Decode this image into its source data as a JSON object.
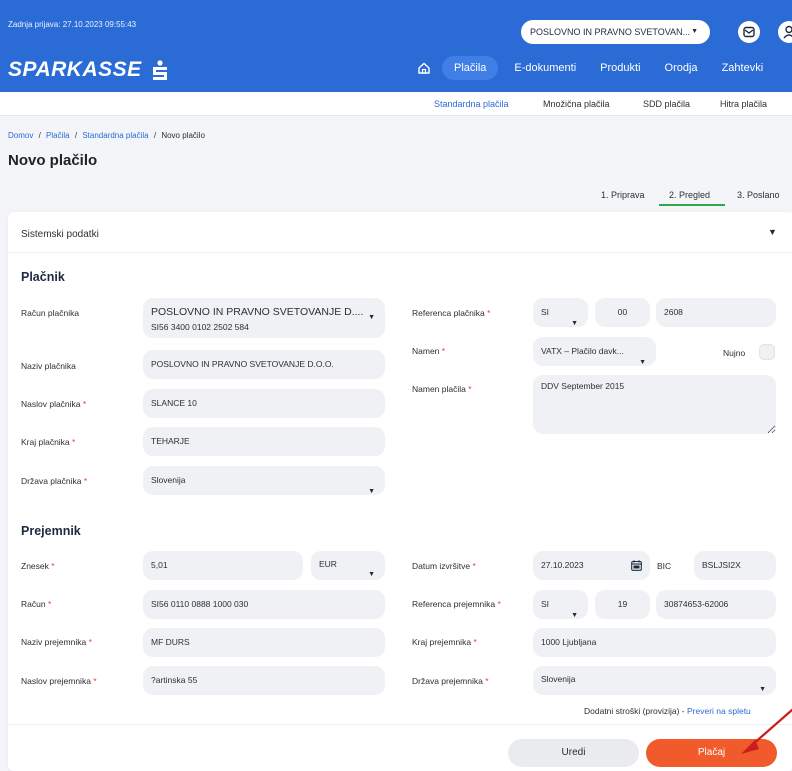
{
  "header": {
    "last_login": "Zadnja prijava: 27.10.2023 09:55:43",
    "company": "POSLOVNO IN PRAVNO SVETOVAN...",
    "logo_text": "SPARKASSE",
    "nav": [
      "Plačila",
      "E-dokumenti",
      "Produkti",
      "Orodja",
      "Zahtevki"
    ]
  },
  "subnav": [
    "Standardna plačila",
    "Množična plačila",
    "SDD plačila",
    "Hitra plačila"
  ],
  "breadcrumb": {
    "home": "Domov",
    "sep": "/",
    "payments": "Plačila",
    "standard": "Standardna plačila",
    "current": "Novo plačilo"
  },
  "page_title": "Novo plačilo",
  "steps": [
    "1. Priprava",
    "2. Pregled",
    "3. Poslano"
  ],
  "system_data_label": "Sistemski podatki",
  "payer": {
    "title": "Plačnik",
    "account_label": "Račun plačnika",
    "account_name": "POSLOVNO IN PRAVNO SVETOVANJE D....",
    "account_iban": "SI56 3400 0102 2502 584",
    "name_label": "Naziv plačnika",
    "name_value": "POSLOVNO IN PRAVNO SVETOVANJE D.O.O.",
    "address_label": "Naslov plačnika",
    "address_value": "SLANCE 10",
    "city_label": "Kraj plačnika",
    "city_value": "TEHARJE",
    "country_label": "Država plačnika",
    "country_value": "Slovenija",
    "ref_label": "Referenca plačnika",
    "ref_model": "SI",
    "ref_code": "00",
    "ref_number": "2608",
    "purpose_label": "Namen",
    "purpose_value": "VATX – Plačilo davk...",
    "urgent_label": "Nujno",
    "purpose_text_label": "Namen plačila",
    "purpose_text_value": "DDV September 2015"
  },
  "recipient": {
    "title": "Prejemnik",
    "amount_label": "Znesek",
    "amount_value": "5,01",
    "currency": "EUR",
    "account_label": "Račun",
    "account_value": "SI56 0110 0888 1000 030",
    "name_label": "Naziv prejemnika",
    "name_value": "MF DURS",
    "address_label": "Naslov prejemnika",
    "address_value": "?artinska 55",
    "date_label": "Datum izvršitve",
    "date_value": "27.10.2023",
    "bic_label": "BIC",
    "bic_value": "BSLJSI2X",
    "ref_label": "Referenca prejemnika",
    "ref_model": "SI",
    "ref_code": "19",
    "ref_number": "30874653-62006",
    "city_label": "Kraj prejemnika",
    "city_value": "1000 Ljubljana",
    "country_label": "Država prejemnika",
    "country_value": "Slovenija"
  },
  "fees": {
    "text": "Dodatni stroški (provizija) -",
    "link": "Preveri na spletu"
  },
  "actions": {
    "edit": "Uredi",
    "pay": "Plačaj"
  },
  "colors": {
    "brand_blue": "#2b6bd6",
    "pay_orange": "#f15a2b",
    "step_active": "#2eaa4a",
    "annotation_red": "#c81e1e"
  }
}
